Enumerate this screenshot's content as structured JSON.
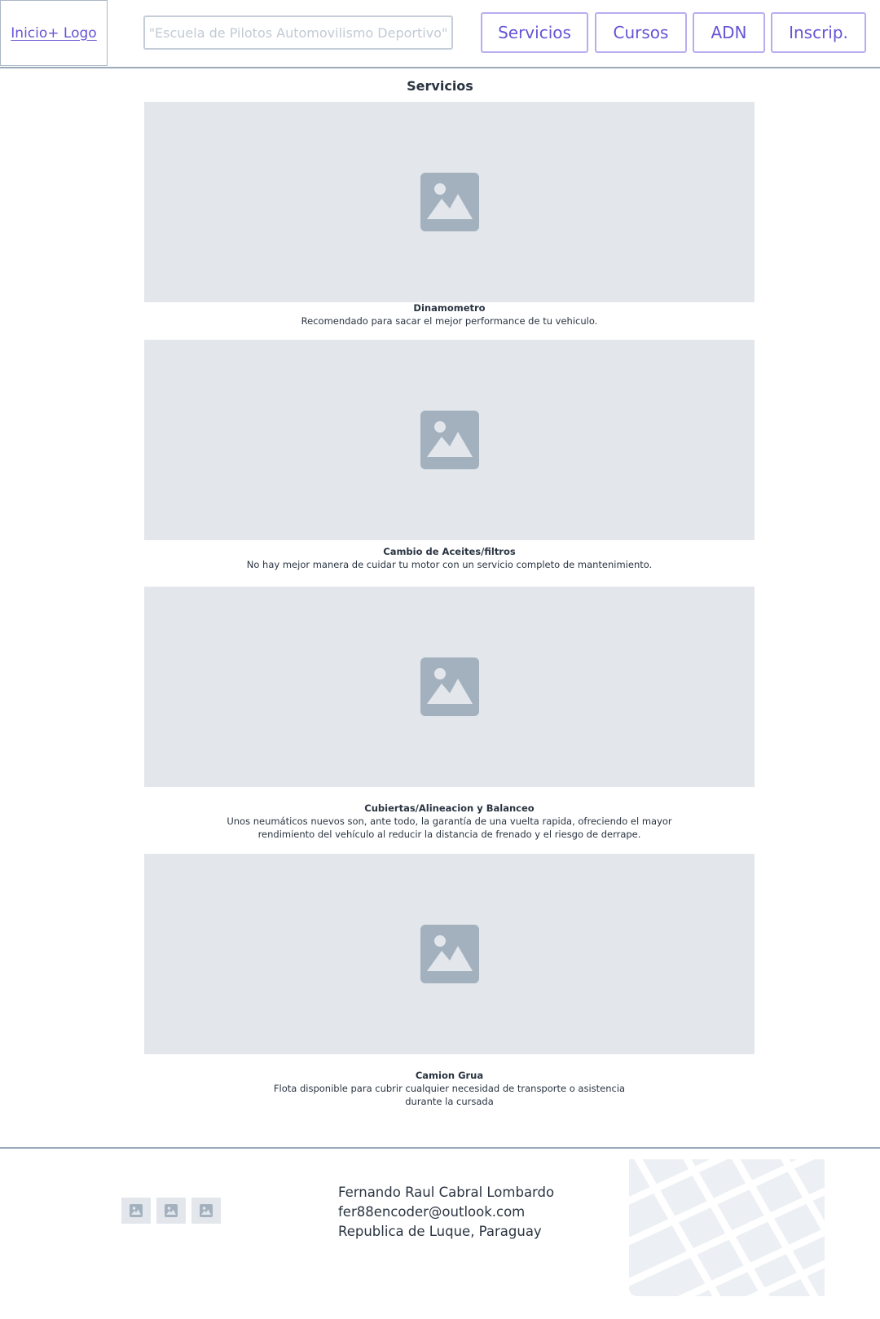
{
  "header": {
    "logo_label": "Inicio+ Logo",
    "tagline": "\"Escuela de Pilotos Automovilismo Deportivo\"",
    "nav": [
      "Servicios",
      "Cursos",
      "ADN",
      "Inscrip."
    ]
  },
  "main": {
    "title": "Servicios",
    "cards": [
      {
        "title": "Dinamometro",
        "desc": "Recomendado para sacar el mejor performance de tu vehiculo."
      },
      {
        "title": "Cambio de Aceites/filtros",
        "desc": "No hay mejor manera de cuidar tu motor con un servicio completo de mantenimiento."
      },
      {
        "title": "Cubiertas/Alineacion y Balanceo",
        "desc_lines": [
          "Unos neumáticos nuevos son, ante todo, la garantía de una vuelta rapida, ofreciendo el mayor",
          "rendimiento del vehículo al reducir la distancia de frenado y el riesgo de derrape."
        ]
      },
      {
        "title": "Camion Grua",
        "desc_lines": [
          "Flota disponible para cubrir cualquier necesidad de transporte o asistencia",
          "durante la cursada"
        ]
      }
    ]
  },
  "footer": {
    "contact": {
      "name": "Fernando Raul Cabral Lombardo",
      "email": "fer88encoder@outlook.com",
      "location": "Republica de Luque, Paraguay"
    },
    "social_icons": [
      "image-icon",
      "image-icon",
      "image-icon"
    ],
    "map_icon": "map-placeholder"
  },
  "colors": {
    "accent": "#6554d6",
    "placeholder_bg": "#e3e7ec",
    "placeholder_icon": "#a3b1bf",
    "rule": "#9aa9b8"
  }
}
